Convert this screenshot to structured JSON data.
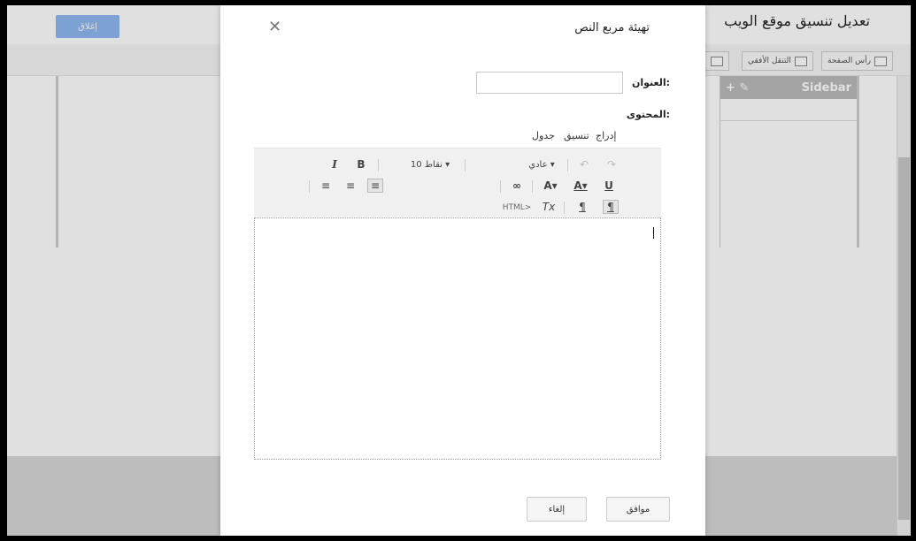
{
  "background": {
    "close_button": "إغلاق",
    "page_title": "تعديل تنسيق موقع الويب",
    "tabs": [
      {
        "label": "رأس الصفحة"
      },
      {
        "label": "التنقل الأفقي"
      }
    ],
    "sidebar_title": "Sidebar",
    "sidebar_actions": "+ ✎"
  },
  "dialog": {
    "title": "تهيئة مربع النص",
    "close_icon": "✕",
    "title_label": "العنوان:",
    "content_label": "المحتوى:",
    "menus": [
      {
        "label": "إدراج"
      },
      {
        "label": "تنسيق"
      },
      {
        "label": "جدول"
      }
    ],
    "toolbar": {
      "undo": "↶",
      "redo": "↷",
      "style_select": "عادي ▾",
      "size_select": "10 نقاط ▾",
      "bold": "B",
      "italic": "I",
      "underline": "U",
      "text_color": "A▾",
      "highlight": "A▾",
      "link": "∞",
      "align_right": "≡",
      "align_center": "≡",
      "align_left": "≡",
      "ltr": "¶",
      "rtl": "¶",
      "clear_format": "Tx",
      "html": "HTML>"
    },
    "ok_button": "موافق",
    "cancel_button": "إلغاء"
  },
  "icons": [
    "close-icon",
    "undo-icon",
    "redo-icon",
    "link-icon",
    "align-right-icon",
    "align-center-icon",
    "align-left-icon",
    "rtl-icon",
    "ltr-icon",
    "clear-format-icon"
  ],
  "colors": {
    "accent": "#8fb8f0",
    "overlay": "#000000",
    "sidebar_header": "#bbbbbb"
  }
}
